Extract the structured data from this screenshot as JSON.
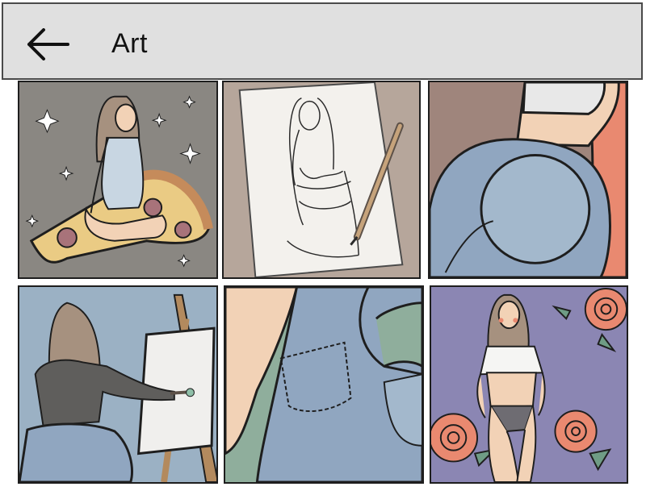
{
  "header": {
    "title": "Art",
    "back_icon": "arrow-left-icon"
  },
  "gallery": {
    "tiles": [
      {
        "subject": "girl-on-pizza",
        "bg": "#8a8782"
      },
      {
        "subject": "pencil-sketch-of-girl",
        "bg": "#b6a69b"
      },
      {
        "subject": "jeans-closeup",
        "bg": "#9f857c"
      },
      {
        "subject": "girl-painting-at-easel",
        "bg": "#9bb1c4"
      },
      {
        "subject": "jeans-pocket-closeup",
        "bg": "#8fae9c"
      },
      {
        "subject": "girl-with-roses",
        "bg": "#8b86b3"
      }
    ]
  },
  "colors": {
    "header_bg": "#e0e0e0",
    "header_border": "#4a4a4a",
    "outline": "#1e1e1e",
    "skin": "#f2d2b6",
    "hair": "#a6917f",
    "denim": "#90a6c0",
    "rose": "#e98970"
  }
}
